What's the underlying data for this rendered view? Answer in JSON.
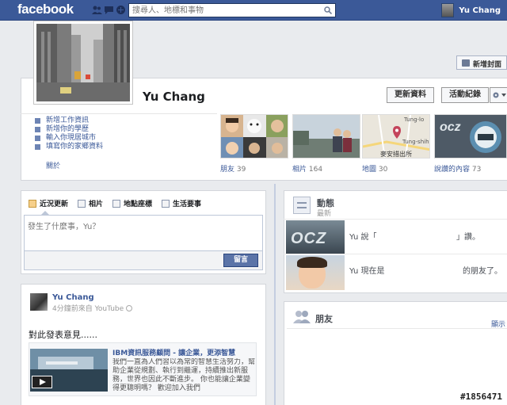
{
  "topbar": {
    "logo": "facebook",
    "search_placeholder": "搜尋人、地標和事物",
    "user_name": "Yu Chang"
  },
  "header": {
    "add_cover_label": "新增封面",
    "name": "Yu Chang",
    "update_info_label": "更新資料",
    "activity_log_label": "活動紀錄"
  },
  "info": {
    "items": [
      "新增工作資訊",
      "新增你的學歷",
      "輸入你現居城市",
      "填寫你的家鄉資料"
    ],
    "about_label": "關於"
  },
  "tiles": [
    {
      "label": "朋友",
      "count": "39"
    },
    {
      "label": "相片",
      "count": "164"
    },
    {
      "label": "地圖",
      "count": "30"
    },
    {
      "label": "說讚的內容",
      "count": "73"
    }
  ],
  "map_text": {
    "place": "Tung-lo",
    "place2": "Tung-shih",
    "caption": "麥安措出所"
  },
  "composer": {
    "tabs": [
      "近況更新",
      "相片",
      "地點座標",
      "生活要事"
    ],
    "placeholder": "發生了什麼事，Yu？",
    "post_label": "留言"
  },
  "post": {
    "author": "Yu Chang",
    "meta": "4分鐘前來自 YouTube",
    "text": "對此發表意見......",
    "share_title": "IBM資訊服務顧問 - 讓企業，更添智慧",
    "share_desc": "我們一直為人們習以為常的智慧生活努力，幫助企業從規劃、執行到繼運，持續推出新服務，世界也因此不斷進步。 你也能讓企業變得更聰明嗎？ 歡迎加入我們"
  },
  "activity": {
    "title": "動態",
    "subtitle": "最新",
    "row1_text": "Yu 說「",
    "row1_end": "」讚。",
    "row2_text": "Yu 現在是",
    "row2_end": "的朋友了。",
    "ocz_text": "OCZ"
  },
  "friends": {
    "title": "朋友",
    "show_link": "顯示"
  },
  "watermark": "#1856471"
}
